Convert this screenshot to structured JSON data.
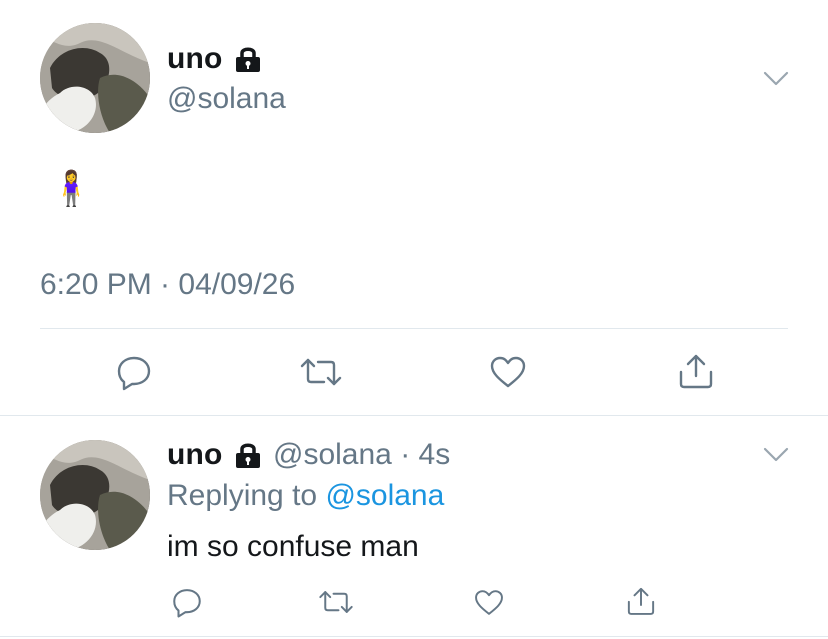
{
  "main_tweet": {
    "display_name": "uno",
    "handle": "@solana",
    "content_emoji": "🧍‍♀️",
    "timestamp": "6:20 PM · 04/09/26"
  },
  "reply_tweet": {
    "display_name": "uno",
    "handle": "@solana",
    "separator": "·",
    "age": "4s",
    "replying_to_prefix": "Replying to ",
    "replying_to_handle": "@solana",
    "text": "im so confuse man"
  },
  "icons": {
    "lock": "lock-icon",
    "menu": "chevron-down-icon",
    "reply": "reply-icon",
    "retweet": "retweet-icon",
    "like": "heart-icon",
    "share": "share-icon"
  },
  "colors": {
    "text": "#14171a",
    "secondary": "#657786",
    "link": "#1b95e0",
    "divider": "#e1e8ed"
  }
}
